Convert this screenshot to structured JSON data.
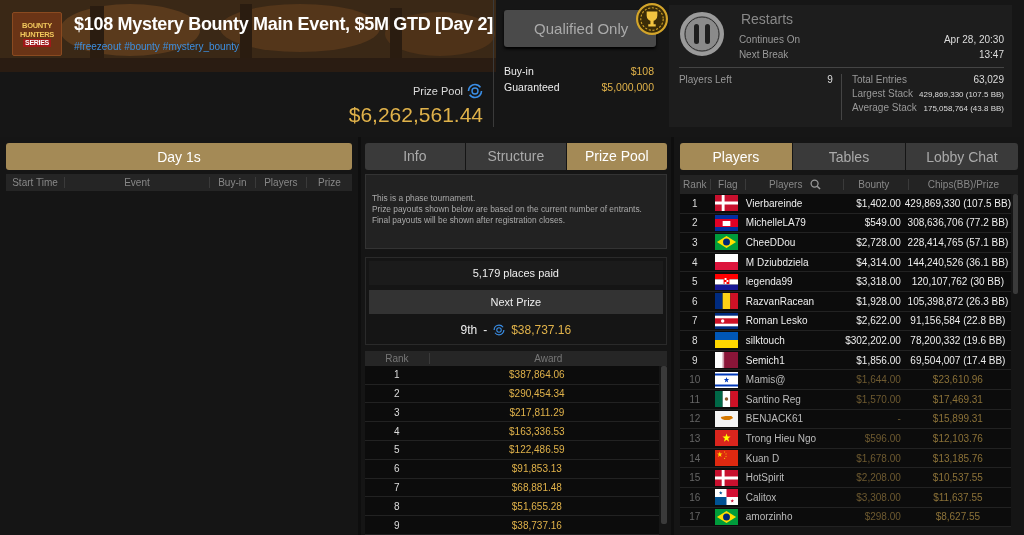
{
  "header": {
    "logo": [
      "BOUNTY",
      "HUNTERS",
      "SERIES"
    ],
    "title": "$108 Mystery Bounty Main Event, $5M GTD [Day 2]",
    "tags": [
      "#freezeout",
      "#bounty",
      "#mystery_bounty"
    ],
    "prize_pool": {
      "label": "Prize Pool",
      "value": "$6,262,561.44"
    },
    "qualified_button": "Qualified Only",
    "fees": [
      {
        "label": "Buy-in",
        "value": "$108"
      },
      {
        "label": "Guaranteed",
        "value": "$5,000,000"
      }
    ],
    "status": {
      "title": "Restarts",
      "rows": [
        {
          "label": "Continues On",
          "value": "Apr 28, 20:30"
        },
        {
          "label": "Next Break",
          "value": "13:47"
        }
      ]
    },
    "players_left": {
      "label": "Players Left",
      "value": "9"
    },
    "stats": [
      {
        "label": "Total Entries",
        "value": "63,029"
      },
      {
        "label": "Largest Stack",
        "value": "429,869,330 (107.5 BB)"
      },
      {
        "label": "Average Stack",
        "value": "175,058,764 (43.8 BB)"
      }
    ]
  },
  "left_panel": {
    "title": "Day 1s",
    "columns": [
      "Start Time",
      "Event",
      "Buy-in",
      "Players",
      "Prize"
    ]
  },
  "middle_panel": {
    "tabs": [
      {
        "label": "Info",
        "selected": false
      },
      {
        "label": "Structure",
        "selected": false
      },
      {
        "label": "Prize Pool",
        "selected": true
      }
    ],
    "info": [
      "This is a phase tournament.",
      "Prize payouts shown below are based on the current number of entrants.",
      "Final payouts will be shown after registration closes."
    ],
    "places_paid": "5,179 places paid",
    "next_prize": {
      "label": "Next Prize",
      "place": "9th",
      "separator": "-",
      "amount": "$38,737.16"
    },
    "award_table": {
      "columns": [
        "Rank",
        "Award"
      ],
      "rows": [
        [
          "1",
          "$387,864.06"
        ],
        [
          "2",
          "$290,454.34"
        ],
        [
          "3",
          "$217,811.29"
        ],
        [
          "4",
          "$163,336.53"
        ],
        [
          "5",
          "$122,486.59"
        ],
        [
          "6",
          "$91,853.13"
        ],
        [
          "7",
          "$68,881.48"
        ],
        [
          "8",
          "$51,655.28"
        ],
        [
          "9",
          "$38,737.16"
        ]
      ]
    }
  },
  "right_panel": {
    "tabs": [
      {
        "label": "Players",
        "selected": true
      },
      {
        "label": "Tables",
        "selected": false
      },
      {
        "label": "Lobby Chat",
        "selected": false
      }
    ],
    "columns": [
      "Rank",
      "Flag",
      "Players",
      "Bounty",
      "Chips(BB)/Prize"
    ],
    "rows": [
      {
        "rank": "1",
        "kind": "denmark",
        "name": "Vierbareinde",
        "bounty": "$1,402.00",
        "chips": "429,869,330 (107.5 BB)",
        "eliminated": false
      },
      {
        "rank": "2",
        "kind": "cambodia",
        "name": "MichelleLA79",
        "bounty": "$549.00",
        "chips": "308,636,706 (77.2 BB)",
        "eliminated": false
      },
      {
        "rank": "3",
        "kind": "brazil",
        "name": "CheeDDou",
        "bounty": "$2,728.00",
        "chips": "228,414,765 (57.1 BB)",
        "eliminated": false
      },
      {
        "rank": "4",
        "kind": "poland",
        "name": "M Dziubdziela",
        "bounty": "$4,314.00",
        "chips": "144,240,526 (36.1 BB)",
        "eliminated": false
      },
      {
        "rank": "5",
        "kind": "croatia",
        "name": "legenda99",
        "bounty": "$3,318.00",
        "chips": "120,107,762 (30 BB)",
        "eliminated": false
      },
      {
        "rank": "6",
        "kind": "romania",
        "name": "RazvanRacean",
        "bounty": "$1,928.00",
        "chips": "105,398,872 (26.3 BB)",
        "eliminated": false
      },
      {
        "rank": "7",
        "kind": "costa_rica",
        "name": "Roman Lesko",
        "bounty": "$2,622.00",
        "chips": "91,156,584 (22.8 BB)",
        "eliminated": false
      },
      {
        "rank": "8",
        "kind": "ukraine",
        "name": "silktouch",
        "bounty": "$302,202.00",
        "chips": "78,200,332 (19.6 BB)",
        "eliminated": false
      },
      {
        "rank": "9",
        "kind": "qatar",
        "name": "Semich1",
        "bounty": "$1,856.00",
        "chips": "69,504,007 (17.4 BB)",
        "eliminated": false
      },
      {
        "rank": "10",
        "kind": "israel",
        "name": "Mamis@",
        "bounty": "$1,644.00",
        "chips": "$23,610.96",
        "eliminated": true
      },
      {
        "rank": "11",
        "kind": "mexico",
        "name": "Santino Reg",
        "bounty": "$1,570.00",
        "chips": "$17,469.31",
        "eliminated": true
      },
      {
        "rank": "12",
        "kind": "cyprus",
        "name": "BENJACK61",
        "bounty": "-",
        "chips": "$15,899.31",
        "eliminated": true
      },
      {
        "rank": "13",
        "kind": "vietnam",
        "name": "Trong Hieu Ngo",
        "bounty": "$596.00",
        "chips": "$12,103.76",
        "eliminated": true
      },
      {
        "rank": "14",
        "kind": "china",
        "name": "Kuan D",
        "bounty": "$1,678.00",
        "chips": "$13,185.76",
        "eliminated": true
      },
      {
        "rank": "15",
        "kind": "denmark",
        "name": "HotSpirit",
        "bounty": "$2,208.00",
        "chips": "$10,537.55",
        "eliminated": true
      },
      {
        "rank": "16",
        "kind": "panama",
        "name": "Calitox",
        "bounty": "$3,308.00",
        "chips": "$11,637.55",
        "eliminated": true
      },
      {
        "rank": "17",
        "kind": "brazil",
        "name": "amorzinho",
        "bounty": "$298.00",
        "chips": "$8,627.55",
        "eliminated": true
      }
    ]
  }
}
